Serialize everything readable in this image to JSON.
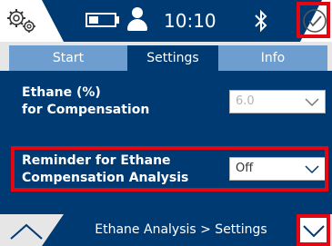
{
  "status": {
    "time": "10:10",
    "icons": [
      "gear-icon",
      "battery-icon",
      "user-icon",
      "bluetooth-icon",
      "checkmark-icon"
    ]
  },
  "tabs": [
    {
      "label": "Start"
    },
    {
      "label": "Settings",
      "active": true
    },
    {
      "label": "Info"
    }
  ],
  "settings": {
    "ethane": {
      "label_line1": "Ethane (%)",
      "label_line2": "for Compensation",
      "value": "6.0"
    },
    "reminder": {
      "label_line1": "Reminder for Ethane",
      "label_line2": "Compensation Analysis",
      "value": "Off"
    }
  },
  "footer": {
    "breadcrumb": "Ethane Analysis > Settings"
  },
  "colors": {
    "primary": "#003a73",
    "tab_inactive": "#6e9ecf",
    "highlight": "#e30613"
  }
}
